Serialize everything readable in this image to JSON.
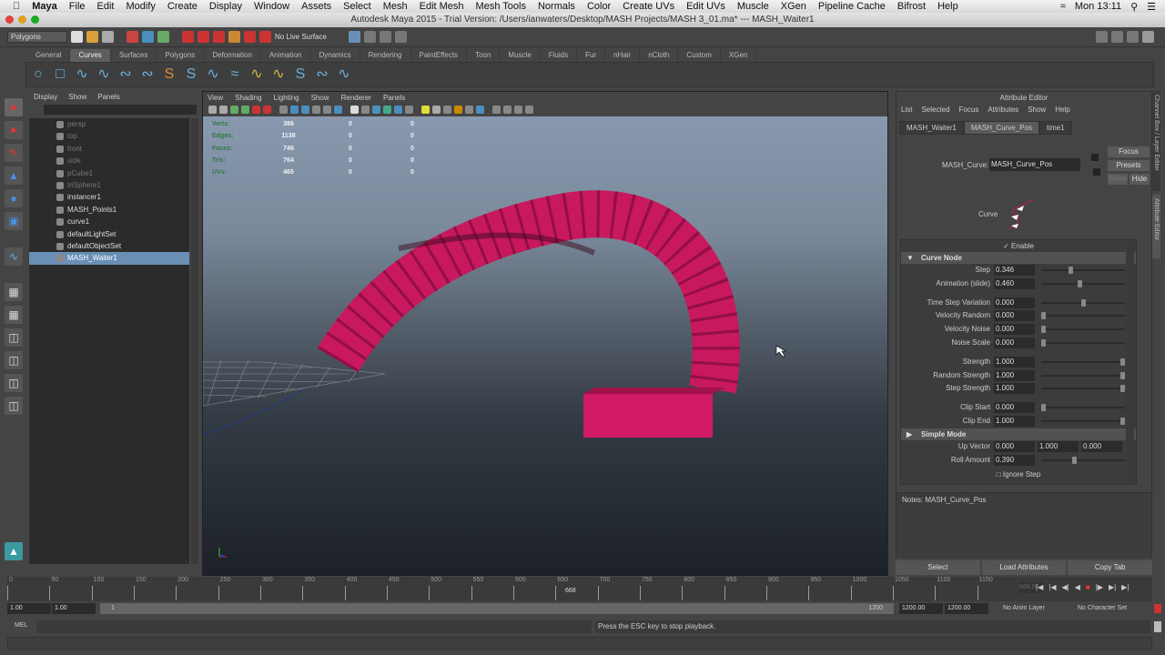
{
  "mac_menu": {
    "items": [
      "Maya",
      "File",
      "Edit",
      "Modify",
      "Create",
      "Display",
      "Window",
      "Assets",
      "Select",
      "Mesh",
      "Edit Mesh",
      "Mesh Tools",
      "Normals",
      "Color",
      "Create UVs",
      "Edit UVs",
      "Muscle",
      "XGen",
      "Pipeline Cache",
      "Bifrost",
      "Help"
    ],
    "clock": "Mon 13:11"
  },
  "window_title": "Autodesk Maya 2015 - Trial Version: /Users/ianwaters/Desktop/MASH Projects/MASH 3_01.ma*  ---  MASH_Waiter1",
  "status_line": {
    "menu_set": "Polygons",
    "live_surface": "No Live Surface"
  },
  "shelf": {
    "tabs": [
      "General",
      "Curves",
      "Surfaces",
      "Polygons",
      "Deformation",
      "Animation",
      "Dynamics",
      "Rendering",
      "PaintEffects",
      "Toon",
      "Muscle",
      "Fluids",
      "Fur",
      "nHair",
      "nCloth",
      "Custom",
      "XGen"
    ],
    "active": "Curves"
  },
  "outliner": {
    "menu": [
      "Display",
      "Show",
      "Panels"
    ],
    "items": [
      {
        "label": "persp",
        "dim": true
      },
      {
        "label": "top",
        "dim": true
      },
      {
        "label": "front",
        "dim": true
      },
      {
        "label": "side",
        "dim": true
      },
      {
        "label": "pCube1",
        "dim": true
      },
      {
        "label": "triSphere1",
        "dim": true
      },
      {
        "label": "instancer1"
      },
      {
        "label": "MASH_Points1"
      },
      {
        "label": "curve1"
      },
      {
        "label": "defaultLightSet"
      },
      {
        "label": "defaultObjectSet"
      },
      {
        "label": "MASH_Waiter1",
        "selected": true
      }
    ]
  },
  "viewport": {
    "menu": [
      "View",
      "Shading",
      "Lighting",
      "Show",
      "Renderer",
      "Panels"
    ],
    "hud": [
      [
        "Verts:",
        "386",
        "0",
        "0"
      ],
      [
        "Edges:",
        "1138",
        "0",
        "0"
      ],
      [
        "Faces:",
        "746",
        "0",
        "0"
      ],
      [
        "Tris:",
        "764",
        "0",
        "0"
      ],
      [
        "UVs:",
        "465",
        "0",
        "0"
      ]
    ],
    "object_color": "#c8185e"
  },
  "attribute_editor": {
    "title": "Attribute Editor",
    "menu": [
      "List",
      "Selected",
      "Focus",
      "Attributes",
      "Show",
      "Help"
    ],
    "tabs": [
      "MASH_Waiter1",
      "MASH_Curve_Pos",
      "time1"
    ],
    "active_tab": "MASH_Curve_Pos",
    "node_label": "MASH_Curve:",
    "node_value": "MASH_Curve_Pos",
    "buttons": {
      "focus": "Focus",
      "presets": "Presets",
      "show": "Show",
      "hide": "Hide"
    },
    "icon_label": "Curve",
    "enable": "Enable",
    "section1": "Curve Node",
    "section2": "Simple Mode",
    "groups": [
      [
        {
          "label": "Step",
          "value": "0.346",
          "slider": 0.346
        },
        {
          "label": "Animation (slide)",
          "value": "0.460",
          "slider": 0.46
        }
      ],
      [
        {
          "label": "Time Step Variation",
          "value": "0.000",
          "slider": 0.5
        },
        {
          "label": "Velocity Random",
          "value": "0.000",
          "slider": 0
        },
        {
          "label": "Velocity Noise",
          "value": "0.000",
          "slider": 0
        },
        {
          "label": "Noise Scale",
          "value": "0.000",
          "slider": 0
        }
      ],
      [
        {
          "label": "Strength",
          "value": "1.000",
          "slider": 1
        },
        {
          "label": "Random Strength",
          "value": "1.000",
          "slider": 1
        },
        {
          "label": "Step Strength",
          "value": "1.000",
          "slider": 1
        }
      ],
      [
        {
          "label": "Clip Start",
          "value": "0.000",
          "slider": 0
        },
        {
          "label": "Clip End",
          "value": "1.000",
          "slider": 1
        }
      ]
    ],
    "up_vector": {
      "label": "Up Vector",
      "values": [
        "0.000",
        "1.000",
        "0.000"
      ]
    },
    "roll_amount": {
      "label": "Roll Amount",
      "value": "0.390",
      "slider": 0.39
    },
    "ignore_step": "Ignore Step",
    "notes": "Notes:  MASH_Curve_Pos",
    "bottom_buttons": [
      "Select",
      "Load Attributes",
      "Copy Tab"
    ],
    "side_tabs": [
      "Channel Box / Layer Editor",
      "Attribute Editor"
    ]
  },
  "timeline": {
    "ticks": [
      "0",
      "50",
      "100",
      "150",
      "200",
      "250",
      "300",
      "350",
      "400",
      "450",
      "500",
      "550",
      "600",
      "650",
      "700",
      "750",
      "800",
      "850",
      "900",
      "950",
      "1000",
      "1050",
      "1100",
      "1150"
    ],
    "current_frame": "668",
    "current_value": 668,
    "max": 1200,
    "frame_field": "668.00"
  },
  "range": {
    "start": "1.00",
    "start2": "1.00",
    "slider_start": "1",
    "slider_end": "1200",
    "end": "1200.00",
    "end2": "1200.00",
    "anim_layer": "No Anim Layer",
    "char_set": "No Character Set"
  },
  "command": {
    "label": "MEL",
    "response": "Press the ESC key to stop playback."
  }
}
